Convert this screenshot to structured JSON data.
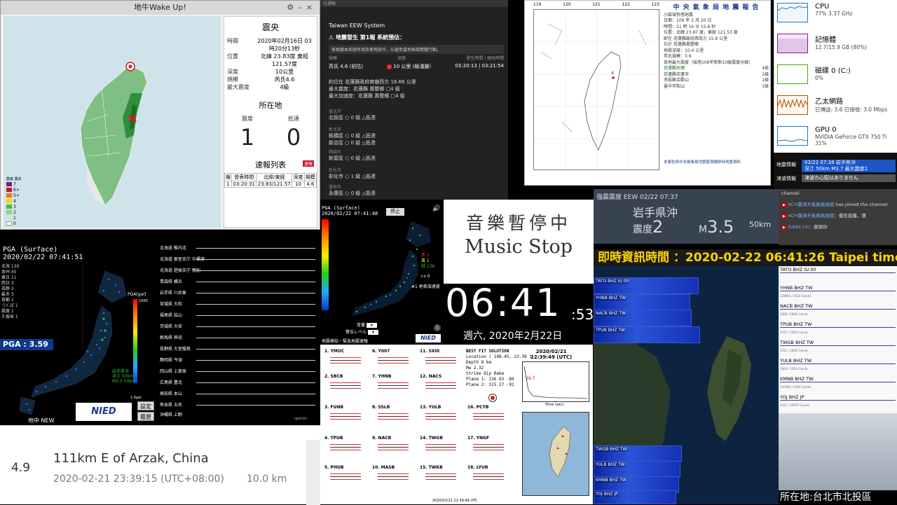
{
  "eew_app": {
    "title": "地牛Wake Up!",
    "panel_title": "震央",
    "rows": [
      {
        "label": "時間",
        "value": "2020年02月16日 03時20分13秒"
      },
      {
        "label": "位置",
        "value": "北緯 23.83度 東經 121.57度"
      },
      {
        "label": "深度",
        "value": "10公里"
      },
      {
        "label": "規模",
        "value": "芮氏4.6"
      },
      {
        "label": "最大震度",
        "value": "4級"
      }
    ],
    "location_title": "所在地",
    "intensity_label": "震度",
    "arrival_label": "抵達",
    "intensity_value": "1",
    "arrival_value": "0",
    "report_list_title": "速報列表",
    "report_badge": "速報",
    "list_headers": [
      "報",
      "發表時間",
      "北緯/東經",
      "深度",
      "規模"
    ],
    "list_row": [
      "1",
      "03:20:31",
      "23.83/121.57",
      "10",
      "4.6"
    ],
    "legend": [
      {
        "label": "7",
        "color": "#7b1e7a"
      },
      {
        "label": "6+",
        "color": "#c0182b"
      },
      {
        "label": "5+",
        "color": "#ff6f1e"
      },
      {
        "label": "4",
        "color": "#ffd400"
      },
      {
        "label": "3",
        "color": "#58b33b"
      },
      {
        "label": "2",
        "color": "#8fd08a"
      },
      {
        "label": "1",
        "color": "#c8ecc8"
      },
      {
        "label": "0",
        "color": "#ffffff"
      }
    ],
    "legend_title": "震度 震央"
  },
  "taiwan_eew": {
    "header": "已通報",
    "system": "Taiwan EEW System",
    "headline": "地震發生  第1報  系統預估：",
    "warning": "係根據本系統所測及使用指令，以避免當地採取應變行動。",
    "col_labels": [
      "規模",
      "深度",
      "發生時間 | 預估時間"
    ],
    "magnitude": "芮氏 4.6 (初估)",
    "depth": "10 公里 (極淺層)",
    "times": "03:20:13 | 03:21:54",
    "epicenter": "約位在 花蓮縣政府南偏西方 18.66 公里",
    "max_intensity": "最大震度：花蓮縣 壽豐鄉  □4 級",
    "max_accel": "最大加速度：花蓮縣 壽豐鄉  □4 級",
    "regions": [
      {
        "region": "臺北市",
        "name": "北投區",
        "level": "0 級",
        "note": "△抵達"
      },
      {
        "region": "新北市",
        "name": "板橋區",
        "level": "0 級",
        "note": "△抵達"
      },
      {
        "region": "",
        "name": "新店區",
        "level": "0 級",
        "note": "△抵達"
      },
      {
        "region": "桃園市",
        "name": "新屋區",
        "level": "0 級",
        "note": "△抵達"
      },
      {
        "region": "彰化市",
        "name": "彰化市",
        "level": "1 級",
        "note": "△抵達"
      },
      {
        "region": "臺南市",
        "name": "永康區",
        "level": "0 級",
        "note": "△抵達"
      }
    ]
  },
  "cwb_report": {
    "title": "中 央 氣 象 局 地 震 報 告",
    "lines": [
      "小區域有感地震",
      "日期：109 年 2 月 20 日",
      "時間：21 時 16 分 15.8 秒",
      "位置：北緯 23.87 度，東經 121.53 度",
      "即在 花蓮縣政府西南方 15.8 公里",
      "位於 花蓮縣壽豐鄉",
      "地震深度：10.4 公里",
      "芮氏規模：3.9",
      "各地最大震度（採用109年新制10級震度分級）"
    ],
    "intensity_rows": [
      {
        "place": "花蓮縣水璉",
        "level": "4級"
      },
      {
        "place": "花蓮縣花蓮市",
        "level": "2級"
      },
      {
        "place": "南投縣合歡山",
        "level": "1級"
      },
      {
        "place": "臺中市梨山",
        "level": "1級"
      }
    ],
    "footer": "本報告係中央氣象局地震觀測網即時地震資料",
    "map_ticks_x": [
      "119",
      "120",
      "121",
      "122",
      "123"
    ]
  },
  "task_manager": [
    {
      "name": "CPU",
      "value": "77%  3.37 GHz",
      "color": "#1979ca"
    },
    {
      "name": "記憶體",
      "value": "12.7/15.9 GB (80%)",
      "color": "#8b12ae"
    },
    {
      "name": "磁碟 0 (C:)",
      "value": "0%",
      "color": "#4da60c"
    },
    {
      "name": "乙太網路",
      "value": "已傳送: 3.6  已接收: 3.0 Mbps",
      "color": "#a74f01"
    },
    {
      "name": "GPU 0",
      "value": "NVIDIA GeForce GTX 750 Ti\n31%",
      "color": "#1979ca"
    }
  ],
  "quake_info": {
    "label1": "地震情報",
    "text1": "02/22  07:38  岩手県沖\n深さ 50km  M3.7  最大震度2",
    "label2": "津波情報",
    "text2": "津波の心配はありません"
  },
  "kyoshin": {
    "header": "強震震度  EEW  02/22  07:37",
    "place": "岩手県沖",
    "shindo_label": "震度",
    "shindo": "2",
    "mag_label": "M",
    "mag": "3.5",
    "depth": "50km"
  },
  "chat": [
    {
      "user": "",
      "text": "channel"
    },
    {
      "user": "KCH臺灣天氣颱風頻道",
      "text": "has joined the channel."
    },
    {
      "user": "KCH臺灣天氣颱風頻道",
      "text": "：優良直播，讚"
    },
    {
      "user": "Eddie Lin",
      "text": "：謝謝你"
    }
  ],
  "time_banner": "即時資訊時間 ：2020-02-22 06:41:26 Taipei time",
  "hinet": {
    "title": "PGA (Surface)",
    "datetime": "2020/02/22 07:41:51",
    "info_lines": [
      "北海 130",
      "本州 45",
      "東日 11",
      "西日 3",
      "長野 2",
      "最多 3",
      "首都 1",
      "つくば 1",
      "震度 1",
      "久留米 1"
    ],
    "pga_value": "PGA : 3.59",
    "stations": [
      "北海道 稚内北",
      "北海道 根室支庁 中標津",
      "北海道 胆振支庁 穂別",
      "青森県 横浜",
      "岩手県 川井東",
      "宮城県 大和",
      "福島県 桧山",
      "茨城県 大宮",
      "群馬県 神流",
      "長野県 大室陽鳥",
      "静岡県 今須",
      "岡山県 上斎原",
      "広島県 豊北",
      "高知県 本山",
      "熊本県 五名",
      "沖縄県 上野"
    ],
    "scale_label": "PGA[gal]",
    "scale_top": "1000",
    "scale_bottom": "1.0gal",
    "epicenter_note": "岩手県沖\n深さ 50km\nM3.5  50km",
    "logo": "NIED",
    "button_settings": "設定",
    "button_history": "履歴",
    "footer": "地中 NEW",
    "footer2": "Igal/div"
  },
  "pga_map": {
    "title": "PGA (Surface)",
    "datetime": "2020/02/22 07:41:48",
    "stop_button": "停止",
    "counts": [
      "赤 1",
      "黄 1",
      "緑 136"
    ],
    "level": "Lv 0",
    "note": "#1 地表加速度",
    "dropdown_label": "音量",
    "volume_label": "警告レベル",
    "footer": "地震検知・緊急地震速報",
    "logo": "NIED"
  },
  "music": {
    "zh": "音樂暫停中",
    "en": "Music Stop"
  },
  "clock": {
    "hm": "06:41",
    "sec": ":53",
    "date": "週六, 2020年2月22日"
  },
  "bats": {
    "stations": [
      "1. YMUC",
      "2. SBCB",
      "3. FUNB",
      "4. TPUB",
      "5. PHUB",
      "6. Y007",
      "7. YHNB",
      "8. SSLB",
      "9. NACB",
      "10. MASB",
      "11. SXI0",
      "12. NACS",
      "13. YULB",
      "14. TWGB",
      "15. TWKB",
      "16. PCYB",
      "17. YNGF",
      "18. LYUB"
    ],
    "best_fit_title": "BEST FIT SOLUTION",
    "best_fit_lines": [
      "Location  ( 108.45, 23.30 )",
      "Depth    8    km",
      "Mw       2.32",
      "         Strike  Dip  Rake",
      "Plane 1:  136   63   -89",
      "Plane 2:  315   27   -91"
    ],
    "datetime": "2020/02/21\n22:39:49 (UTC)",
    "graph_value": "29.7",
    "graph_label": "Time (sec)",
    "footer": "2020/02/21 22:39:49 UTC"
  },
  "spectro": {
    "top": [
      "TATO BHZ IU 00",
      "YHNB BHZ TW",
      "NACB BHZ TW",
      "TPUB BHZ TW"
    ],
    "bottom": [
      "TWGB BHZ TW",
      "YULB BHZ TW",
      "KMNB BHZ TW",
      "YOJ BHZ JP"
    ]
  },
  "stations_right": [
    {
      "name": "TATO BHZ IU 00",
      "count": ""
    },
    {
      "name": "YHNB BHZ TW",
      "count": "528901 / 3534 Counts"
    },
    {
      "name": "NACB BHZ TW",
      "count": "1066 / 5000 Counts"
    },
    {
      "name": "TPUB BHZ TW",
      "count": "1167 / 1502 Counts"
    },
    {
      "name": "TWGB BHZ TW",
      "count": "1011 / 1000 Counts"
    },
    {
      "name": "YULB BHZ TW",
      "count": "1004 / 1501 Counts"
    },
    {
      "name": "KMNB BHZ TW",
      "count": "247000 / 1564 Counts"
    },
    {
      "name": "YOJ BHZ JP",
      "count": "1421 / 10007 Counts"
    }
  ],
  "location": "所在地:台北市北投區",
  "usgs": {
    "magnitude": "4.9",
    "place": "111km E of Arzak, China",
    "time": "2020-02-21 23:39:15 (UTC+08:00)",
    "depth": "10.0 km"
  }
}
